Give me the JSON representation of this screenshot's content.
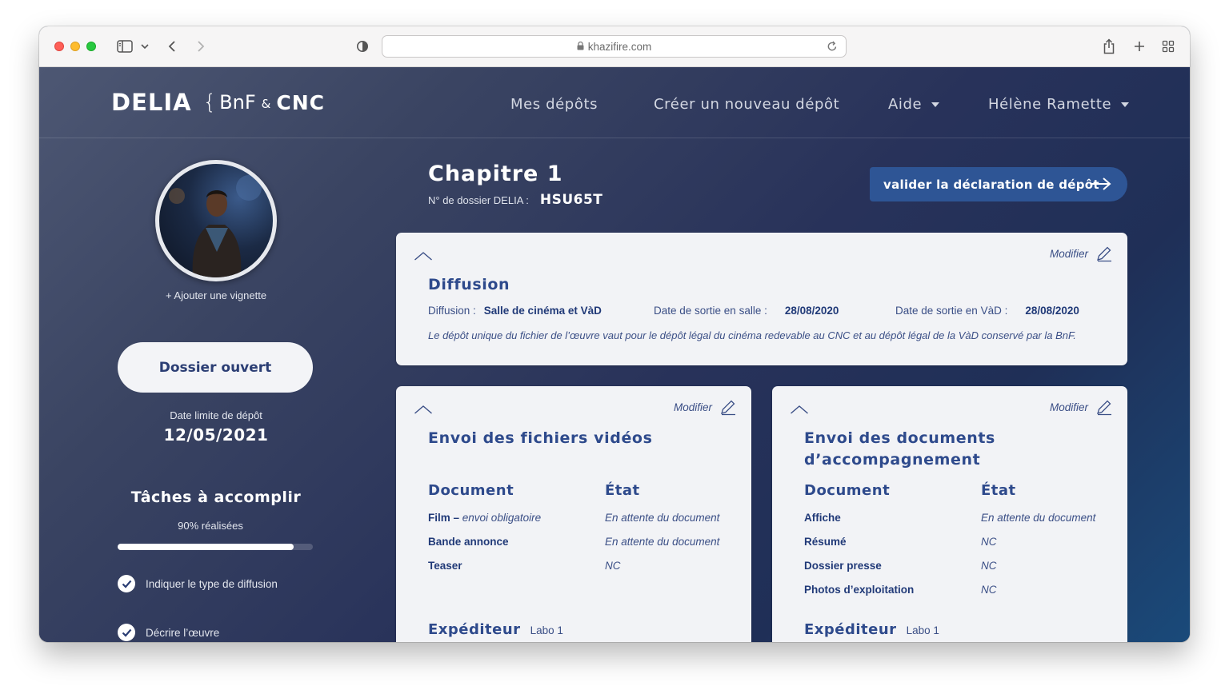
{
  "browser": {
    "url": "khazifire.com"
  },
  "nav": {
    "logo": {
      "delia": "DELIA",
      "brace": "{",
      "bnf": "BnF",
      "amp": "&",
      "cnc": "CNC"
    },
    "items": [
      {
        "label": "Mes dépôts"
      },
      {
        "label": "Créer un nouveau dépôt"
      },
      {
        "label": "Aide"
      },
      {
        "label": "Hélène Ramette"
      }
    ]
  },
  "sidebar": {
    "add_thumbnail": "+ Ajouter une vignette",
    "status": "Dossier ouvert",
    "deadline_label": "Date limite de dépôt",
    "deadline_value": "12/05/2021",
    "tasks": {
      "title": "Tâches à accomplir",
      "percent_label": "90% réalisées",
      "progress": 0.9,
      "items": [
        {
          "label": "Indiquer le type de diffusion"
        },
        {
          "label": "Décrire l’œuvre"
        }
      ]
    }
  },
  "main": {
    "title": "Chapitre 1",
    "dossier_label": "N° de dossier DELIA :",
    "dossier_value": "HSU65T",
    "validate_label": "valider la déclaration de dépôt"
  },
  "diffusion": {
    "modify": "Modifier",
    "title": "Diffusion",
    "fields": [
      {
        "label": "Diffusion :",
        "value": "Salle de cinéma et VàD"
      },
      {
        "label": "Date de sortie en salle :",
        "value": "28/08/2020"
      },
      {
        "label": "Date de sortie en VàD :",
        "value": "28/08/2020"
      }
    ],
    "note": "Le dépôt unique du fichier de l’œuvre vaut pour le dépôt légal du cinéma redevable au CNC et au dépôt légal de la VàD conservé par la BnF."
  },
  "videos": {
    "modify": "Modifier",
    "title": "Envoi des fichiers vidéos",
    "col_document": "Document",
    "col_state": "État",
    "rows": [
      {
        "doc": "Film",
        "sep": " – ",
        "note": "envoi obligatoire",
        "state": "En attente du document"
      },
      {
        "doc": "Bande annonce",
        "state": "En attente du document"
      },
      {
        "doc": "Teaser",
        "state": "NC"
      }
    ],
    "sender_label": "Expéditeur",
    "sender_value": "Labo 1"
  },
  "documents": {
    "modify": "Modifier",
    "title_line1": "Envoi des documents",
    "title_line2": "d’accompagnement",
    "col_document": "Document",
    "col_state": "État",
    "rows": [
      {
        "doc": "Affiche",
        "state": "En attente du document"
      },
      {
        "doc": "Résumé",
        "state": "NC"
      },
      {
        "doc": "Dossier presse",
        "state": "NC"
      },
      {
        "doc": "Photos d’exploitation",
        "state": "NC"
      }
    ],
    "sender_label": "Expéditeur",
    "sender_value": "Labo 1"
  }
}
